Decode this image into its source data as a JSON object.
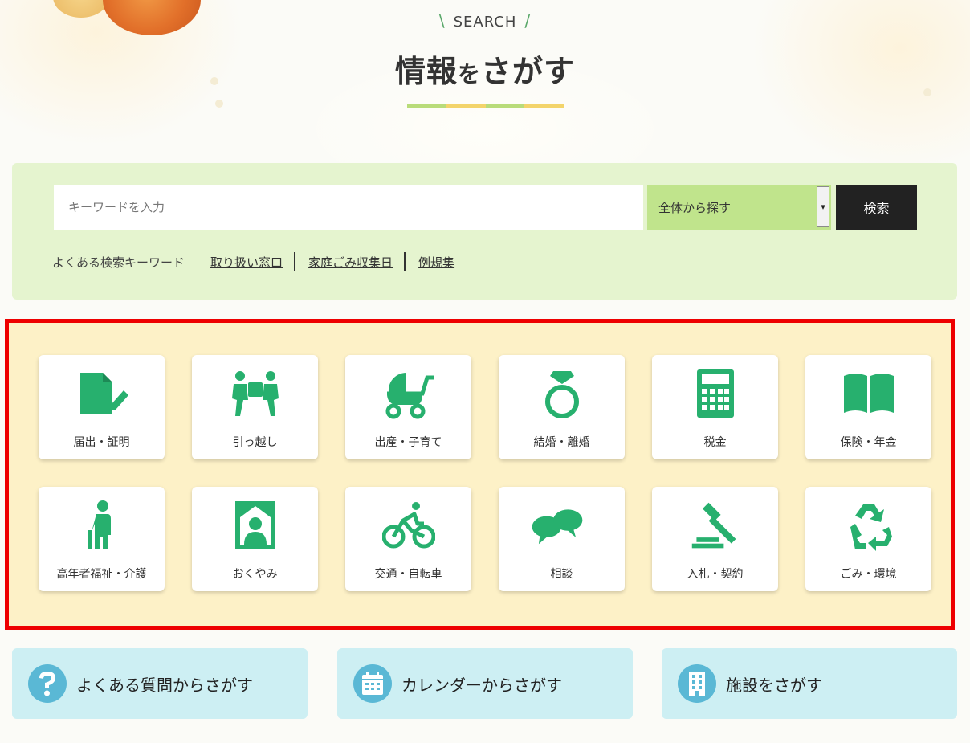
{
  "header": {
    "eyebrow": "SEARCH",
    "title_part1": "情報",
    "title_part2": "を",
    "title_part3": "さがす",
    "underline_colors": [
      "#b9dc7a",
      "#f3d46b",
      "#b9dc7a",
      "#f3d46b"
    ]
  },
  "search": {
    "placeholder": "キーワードを入力",
    "scope_value": "全体から探す",
    "submit_label": "検索",
    "faq_label": "よくある検索キーワード",
    "faq_links": [
      "取り扱い窓口",
      "家庭ごみ収集日",
      "例規集"
    ]
  },
  "categories": {
    "accent": "#27b06e",
    "items": [
      {
        "label": "届出・証明",
        "icon": "document-edit-icon"
      },
      {
        "label": "引っ越し",
        "icon": "moving-icon"
      },
      {
        "label": "出産・子育て",
        "icon": "stroller-icon"
      },
      {
        "label": "結婚・離婚",
        "icon": "ring-icon"
      },
      {
        "label": "税金",
        "icon": "calculator-icon"
      },
      {
        "label": "保険・年金",
        "icon": "book-icon"
      },
      {
        "label": "高年者福祉・介護",
        "icon": "elderly-icon"
      },
      {
        "label": "おくやみ",
        "icon": "portrait-frame-icon"
      },
      {
        "label": "交通・自転車",
        "icon": "bicycle-icon"
      },
      {
        "label": "相談",
        "icon": "speech-bubbles-icon"
      },
      {
        "label": "入札・契約",
        "icon": "gavel-icon"
      },
      {
        "label": "ごみ・環境",
        "icon": "recycle-icon"
      }
    ]
  },
  "nav_cards": [
    {
      "label": "よくある質問からさがす",
      "icon": "question-icon"
    },
    {
      "label": "カレンダーからさがす",
      "icon": "calendar-icon"
    },
    {
      "label": "施設をさがす",
      "icon": "building-icon"
    }
  ]
}
